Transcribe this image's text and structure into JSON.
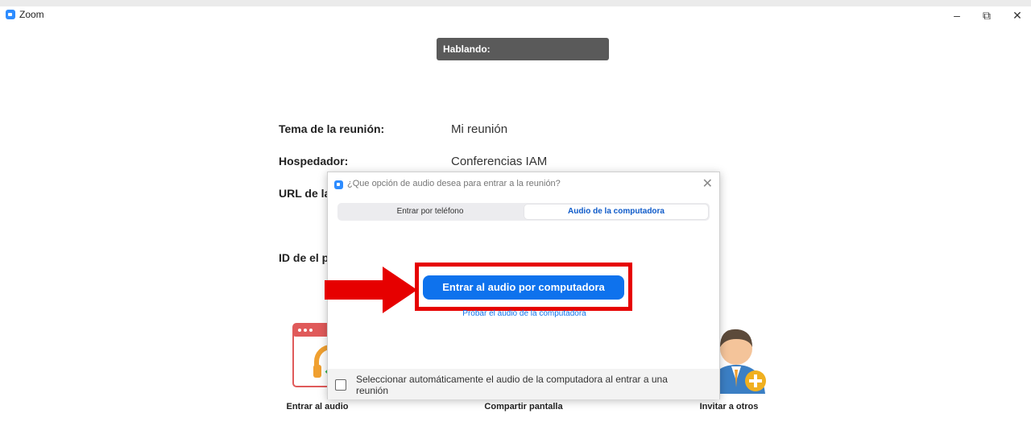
{
  "window": {
    "title": "Zoom"
  },
  "speaking": {
    "label": "Hablando:"
  },
  "meeting": {
    "topic_label": "Tema de la reunión:",
    "topic_value": "Mi reunión",
    "host_label": "Hospedador:",
    "host_value": "Conferencias IAM",
    "url_label": "URL de la",
    "id_label": "ID de el p"
  },
  "actions": [
    {
      "label": "Entrar al audio",
      "icon": "headphone-icon"
    },
    {
      "label": "Compartir pantalla",
      "icon": "share-screen-icon"
    },
    {
      "label": "Invitar a otros",
      "icon": "invite-user-icon"
    }
  ],
  "dialog": {
    "title": "¿Que opción de audio desea para entrar a la reunión?",
    "tabs": [
      {
        "label": "Entrar por teléfono",
        "selected": false
      },
      {
        "label": "Audio de la computadora",
        "selected": true
      }
    ],
    "join_button": "Entrar al audio por computadora",
    "test_link": "Probar el audio de la computadora",
    "auto_checkbox": {
      "label": "Seleccionar automáticamente el audio de la computadora al entrar a una reunión",
      "checked": false
    }
  },
  "colors": {
    "accent": "#0e72ed",
    "highlight": "#e60000",
    "speaking_bg": "#5a5a5a"
  }
}
